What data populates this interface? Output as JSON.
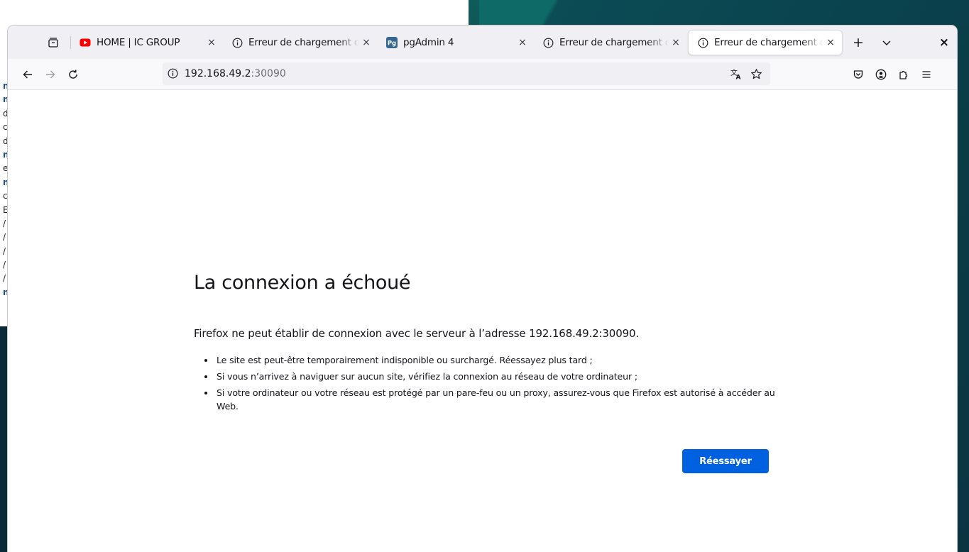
{
  "background": {
    "terminal_letters": [
      "n",
      "n",
      "d",
      "c",
      "d",
      "n",
      "e",
      "n",
      "c",
      "E",
      "/",
      "/",
      "/",
      "/",
      "/",
      "n"
    ],
    "bold_rows": [
      0,
      1,
      5,
      7,
      15
    ]
  },
  "browser": {
    "tabs": [
      {
        "title": "HOME | IC GROUP",
        "icon": "youtube-icon",
        "active": false
      },
      {
        "title": "Erreur de chargement de la page",
        "icon": "info-icon",
        "active": false
      },
      {
        "title": "pgAdmin 4",
        "icon": "pgadmin-icon",
        "active": false
      },
      {
        "title": "Erreur de chargement de la page",
        "icon": "info-icon",
        "active": false
      },
      {
        "title": "Erreur de chargement de la page",
        "icon": "info-icon",
        "active": true
      }
    ],
    "close_glyph": "×",
    "new_tab_glyph": "+",
    "window_close_glyph": "×",
    "url": {
      "host": "192.168.49.2",
      "port": ":30090"
    },
    "colors": {
      "accent": "#0061e0",
      "tabbar": "#f0f0f4",
      "youtube": "#ff0000",
      "pgadmin": "#336791"
    }
  },
  "page": {
    "title": "La connexion a échoué",
    "description": "Firefox ne peut établir de connexion avec le serveur à l’adresse 192.168.49.2:30090.",
    "bullets": [
      "Le site est peut-être temporairement indisponible ou surchargé. Réessayez plus tard ;",
      "Si vous n’arrivez à naviguer sur aucun site, vérifiez la connexion au réseau de votre ordinateur ;",
      "Si votre ordinateur ou votre réseau est protégé par un pare-feu ou un proxy, assurez-vous que Firefox est autorisé à accéder au Web."
    ],
    "retry_label": "Réessayer"
  }
}
